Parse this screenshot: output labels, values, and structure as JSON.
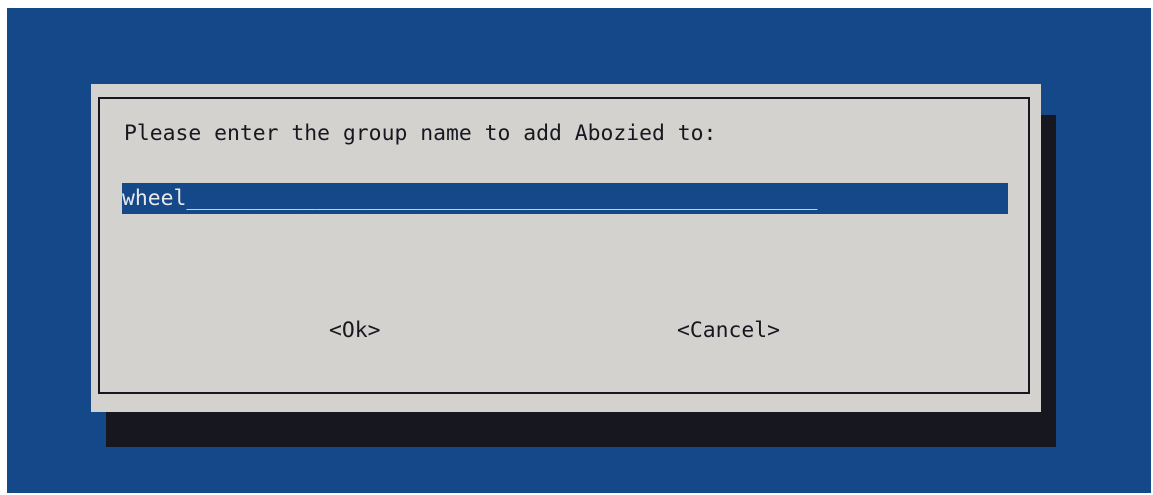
{
  "dialog": {
    "prompt": "Please enter the group name to add Abozied to:",
    "input": {
      "value": "wheel",
      "fill": "_________________________________________________"
    },
    "buttons": {
      "ok": "<Ok>",
      "cancel": "<Cancel>"
    }
  },
  "colors": {
    "background": "#154889",
    "dialog": "#d4d2ce",
    "shadow": "#17171f",
    "input_highlight": "#154889",
    "text": "#17171f",
    "input_text": "#e8e8e8"
  }
}
